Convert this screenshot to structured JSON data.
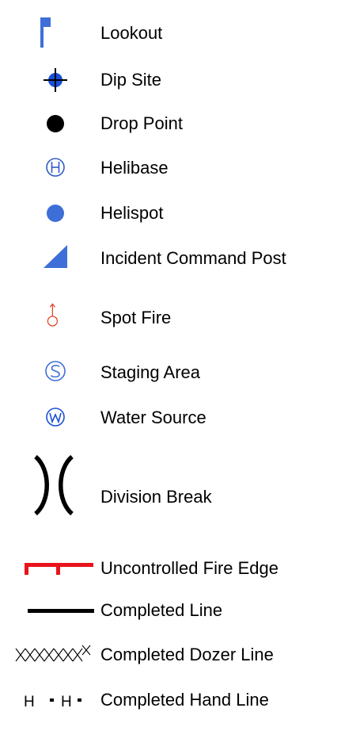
{
  "legend": {
    "items": [
      {
        "label": "Lookout",
        "icon": "lookout-flag",
        "color": "#3e6fd8"
      },
      {
        "label": "Dip Site",
        "icon": "dip-site-crosshair",
        "color": "#1a4fd6"
      },
      {
        "label": "Drop Point",
        "icon": "drop-point-dot",
        "color": "#000000"
      },
      {
        "label": "Helibase",
        "icon": "helibase-circled-h",
        "color": "#2f5bc4"
      },
      {
        "label": "Helispot",
        "icon": "helispot-dot",
        "color": "#3e6fd8"
      },
      {
        "label": "Incident Command Post",
        "icon": "icp-half-square",
        "color": "#3e6fd8"
      },
      {
        "label": "Spot Fire",
        "icon": "spot-fire-arrow-circle",
        "color": "#e0472f"
      },
      {
        "label": "Staging Area",
        "icon": "staging-circled-s",
        "color": "#3e6fd8"
      },
      {
        "label": "Water Source",
        "icon": "water-circled-w",
        "color": "#1a4fd6"
      },
      {
        "label": "Division Break",
        "icon": "division-break-brackets",
        "color": "#000000"
      },
      {
        "label": "Uncontrolled Fire Edge",
        "icon": "fire-edge-line",
        "color": "#e8131b"
      },
      {
        "label": "Completed Line",
        "icon": "completed-line",
        "color": "#000000"
      },
      {
        "label": "Completed Dozer Line",
        "icon": "dozer-line-xxx",
        "color": "#000000"
      },
      {
        "label": "Completed Hand Line",
        "icon": "hand-line-h",
        "color": "#000000",
        "glyph": "H"
      }
    ]
  }
}
